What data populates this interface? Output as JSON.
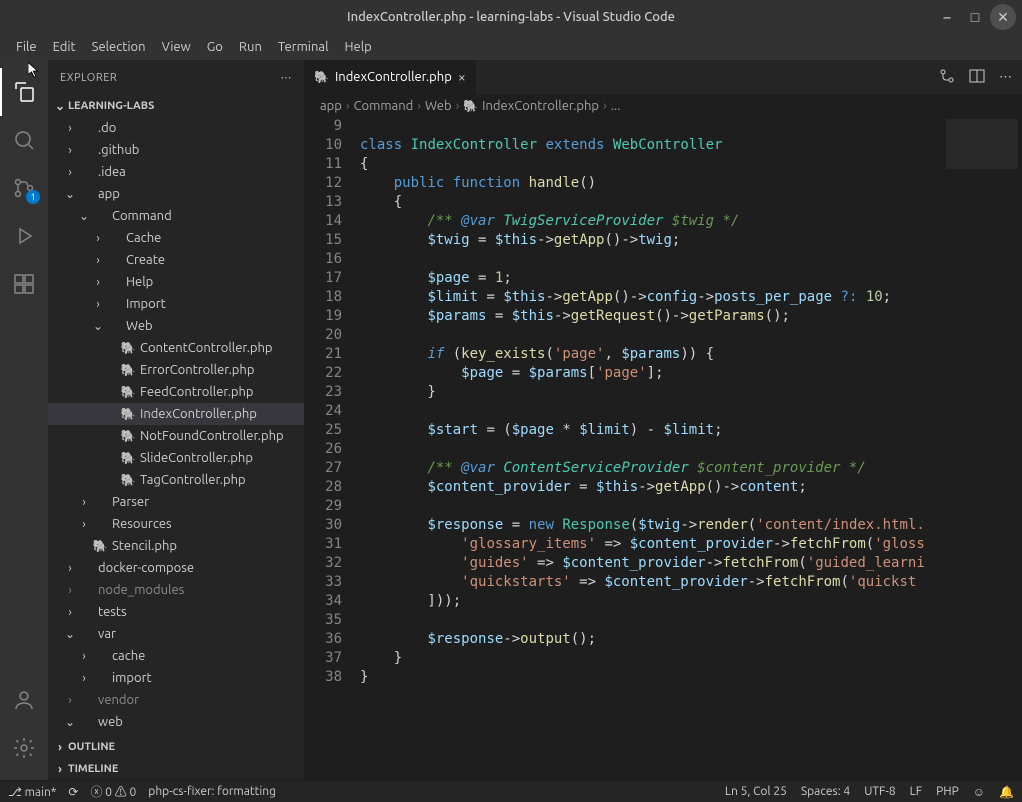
{
  "titlebar": {
    "title": "IndexController.php - learning-labs - Visual Studio Code"
  },
  "menubar": [
    "File",
    "Edit",
    "Selection",
    "View",
    "Go",
    "Run",
    "Terminal",
    "Help"
  ],
  "activity_bar": {
    "scm_badge": "1"
  },
  "sidebar": {
    "title": "EXPLORER",
    "sections": {
      "project": "LEARNING-LABS",
      "outline": "OUTLINE",
      "timeline": "TIMELINE"
    },
    "tree": [
      {
        "type": "folder",
        "open": false,
        "name": ".do",
        "indent": 1
      },
      {
        "type": "folder",
        "open": false,
        "name": ".github",
        "indent": 1
      },
      {
        "type": "folder",
        "open": false,
        "name": ".idea",
        "indent": 1
      },
      {
        "type": "folder",
        "open": true,
        "name": "app",
        "indent": 1
      },
      {
        "type": "folder",
        "open": true,
        "name": "Command",
        "indent": 2
      },
      {
        "type": "folder",
        "open": false,
        "name": "Cache",
        "indent": 3
      },
      {
        "type": "folder",
        "open": false,
        "name": "Create",
        "indent": 3
      },
      {
        "type": "folder",
        "open": false,
        "name": "Help",
        "indent": 3
      },
      {
        "type": "folder",
        "open": false,
        "name": "Import",
        "indent": 3
      },
      {
        "type": "folder",
        "open": true,
        "name": "Web",
        "indent": 3
      },
      {
        "type": "file-php",
        "name": "ContentController.php",
        "indent": 4
      },
      {
        "type": "file-php",
        "name": "ErrorController.php",
        "indent": 4
      },
      {
        "type": "file-php",
        "name": "FeedController.php",
        "indent": 4
      },
      {
        "type": "file-php",
        "name": "IndexController.php",
        "indent": 4,
        "selected": true
      },
      {
        "type": "file-php",
        "name": "NotFoundController.php",
        "indent": 4
      },
      {
        "type": "file-php",
        "name": "SlideController.php",
        "indent": 4
      },
      {
        "type": "file-php",
        "name": "TagController.php",
        "indent": 4
      },
      {
        "type": "folder",
        "open": false,
        "name": "Parser",
        "indent": 2
      },
      {
        "type": "folder",
        "open": false,
        "name": "Resources",
        "indent": 2
      },
      {
        "type": "file-php",
        "name": "Stencil.php",
        "indent": 2
      },
      {
        "type": "folder",
        "open": false,
        "name": "docker-compose",
        "indent": 1
      },
      {
        "type": "folder",
        "open": false,
        "name": "node_modules",
        "indent": 1,
        "dim": true
      },
      {
        "type": "folder",
        "open": false,
        "name": "tests",
        "indent": 1
      },
      {
        "type": "folder",
        "open": true,
        "name": "var",
        "indent": 1
      },
      {
        "type": "folder",
        "open": false,
        "name": "cache",
        "indent": 2
      },
      {
        "type": "folder",
        "open": false,
        "name": "import",
        "indent": 2
      },
      {
        "type": "folder",
        "open": false,
        "name": "vendor",
        "indent": 1,
        "dim": true
      },
      {
        "type": "folder",
        "open": true,
        "name": "web",
        "indent": 1
      }
    ]
  },
  "tabs": [
    {
      "label": "IndexController.php",
      "active": true
    }
  ],
  "breadcrumbs": [
    "app",
    "Command",
    "Web",
    "IndexController.php",
    "..."
  ],
  "editor": {
    "first_line": 9,
    "lines": [
      "",
      "<span class='kw'>class</span> <span class='cls'>IndexController</span> <span class='kw'>extends</span> <span class='cls'>WebController</span>",
      "{",
      "    <span class='kw'>public</span> <span class='kw'>function</span> <span class='fn'>handle</span>()",
      "    {",
      "        <span class='cmt'>/** <span class='tag'>@var</span> <span class='cls'>TwigServiceProvider</span> $twig */</span>",
      "        <span class='var'>$twig</span> = <span class='var'>$this</span>-><span class='fn'>getApp</span>()-><span class='var'>twig</span>;",
      "",
      "        <span class='var'>$page</span> = <span class='num'>1</span>;",
      "        <span class='var'>$limit</span> = <span class='var'>$this</span>-><span class='fn'>getApp</span>()-><span class='var'>config</span>-><span class='var'>posts_per_page</span> <span class='kw'>?:</span> <span class='num'>10</span>;",
      "        <span class='var'>$params</span> = <span class='var'>$this</span>-><span class='fn'>getRequest</span>()-><span class='fn'>getParams</span>();",
      "",
      "        <span class='kw'><i>if</i></span> (<span class='fn'>key_exists</span>(<span class='str'>'page'</span>, <span class='var'>$params</span>)) {",
      "            <span class='var'>$page</span> = <span class='var'>$params</span>[<span class='str'>'page'</span>];",
      "        }",
      "",
      "        <span class='var'>$start</span> = (<span class='var'>$page</span> * <span class='var'>$limit</span>) - <span class='var'>$limit</span>;",
      "",
      "        <span class='cmt'>/** <span class='tag'>@var</span> <span class='cls'>ContentServiceProvider</span> $content_provider */</span>",
      "        <span class='var'>$content_provider</span> = <span class='var'>$this</span>-><span class='fn'>getApp</span>()-><span class='var'>content</span>;",
      "",
      "        <span class='var'>$response</span> = <span class='kw'>new</span> <span class='cls'>Response</span>(<span class='var'>$twig</span>-><span class='fn'>render</span>(<span class='str'>'content/index.html.</span>",
      "            <span class='str'>'glossary_items'</span> =&gt; <span class='var'>$content_provider</span>-><span class='fn'>fetchFrom</span>(<span class='str'>'gloss</span>",
      "            <span class='str'>'guides'</span> =&gt; <span class='var'>$content_provider</span>-><span class='fn'>fetchFrom</span>(<span class='str'>'guided_learni</span>",
      "            <span class='str'>'quickstarts'</span> =&gt; <span class='var'>$content_provider</span>-><span class='fn'>fetchFrom</span>(<span class='str'>'quickst</span>",
      "        ]));",
      "",
      "        <span class='var'>$response</span>-><span class='fn'>output</span>();",
      "    }",
      "}"
    ]
  },
  "statusbar": {
    "branch": "main*",
    "errors": "0",
    "warnings": "0",
    "formatter": "php-cs-fixer: formatting",
    "cursor": "Ln 5, Col 25",
    "spaces": "Spaces: 4",
    "encoding": "UTF-8",
    "eol": "LF",
    "lang": "PHP"
  }
}
